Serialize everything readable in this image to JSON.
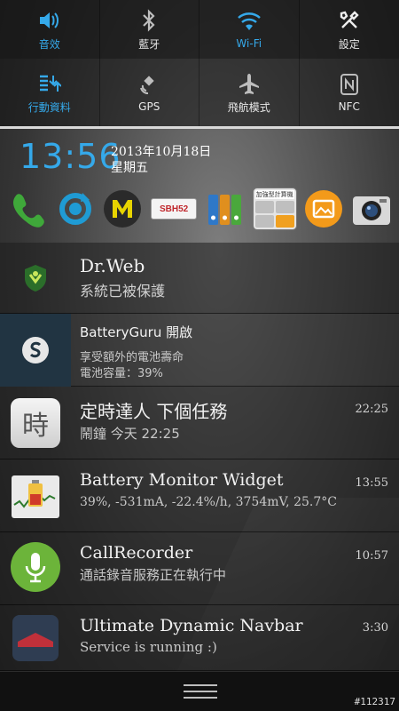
{
  "quick_settings": {
    "row1": [
      {
        "label": "音效",
        "icon": "volume-icon",
        "state": "on"
      },
      {
        "label": "藍牙",
        "icon": "bluetooth-icon",
        "state": "off"
      },
      {
        "label": "Wi-Fi",
        "icon": "wifi-icon",
        "state": "on"
      },
      {
        "label": "設定",
        "icon": "settings-tools-icon",
        "state": "off"
      }
    ],
    "row2": [
      {
        "label": "行動資料",
        "icon": "mobile-data-icon",
        "state": "on"
      },
      {
        "label": "GPS",
        "icon": "gps-satellite-icon",
        "state": "off"
      },
      {
        "label": "飛航模式",
        "icon": "airplane-icon",
        "state": "off"
      },
      {
        "label": "NFC",
        "icon": "nfc-icon",
        "state": "off"
      }
    ]
  },
  "status": {
    "time": "13:56",
    "date": "2013年10月18日",
    "weekday": "星期五"
  },
  "shortcuts": [
    {
      "name": "phone-app",
      "color": "#3fa83a"
    },
    {
      "name": "sync-app",
      "color": "#1f9bd4"
    },
    {
      "name": "m-app",
      "color": "#e8d400"
    },
    {
      "name": "sbh52-app",
      "label": "SBH52"
    },
    {
      "name": "binders-app"
    },
    {
      "name": "calculator-app",
      "label": "加強型計算機"
    },
    {
      "name": "gallery-app",
      "color": "#f39a1a"
    },
    {
      "name": "camera-app"
    }
  ],
  "notifications": [
    {
      "id": "drweb",
      "title": "Dr.Web",
      "text": "系統已被保護",
      "time": ""
    },
    {
      "id": "batteryguru",
      "title": "BatteryGuru 開啟",
      "text": "享受額外的電池壽命",
      "text2": "電池容量：39%",
      "time": ""
    },
    {
      "id": "timer",
      "title": "定時達人 下個任務",
      "text": "鬧鐘 今天 22:25",
      "time": "22:25",
      "icon_char": "時"
    },
    {
      "id": "battery-monitor",
      "title": "Battery Monitor Widget",
      "text": "39%, -531mA, -22.4%/h, 3754mV, 25.7°C",
      "time": "13:55"
    },
    {
      "id": "callrecorder",
      "title": "CallRecorder",
      "text": "通話錄音服務正在執行中",
      "time": "10:57"
    },
    {
      "id": "navbar",
      "title": "Ultimate Dynamic Navbar",
      "text": "Service is running :)",
      "time": "3:30"
    }
  ],
  "watermark": "#112317",
  "colors": {
    "accent": "#35a9ea"
  }
}
